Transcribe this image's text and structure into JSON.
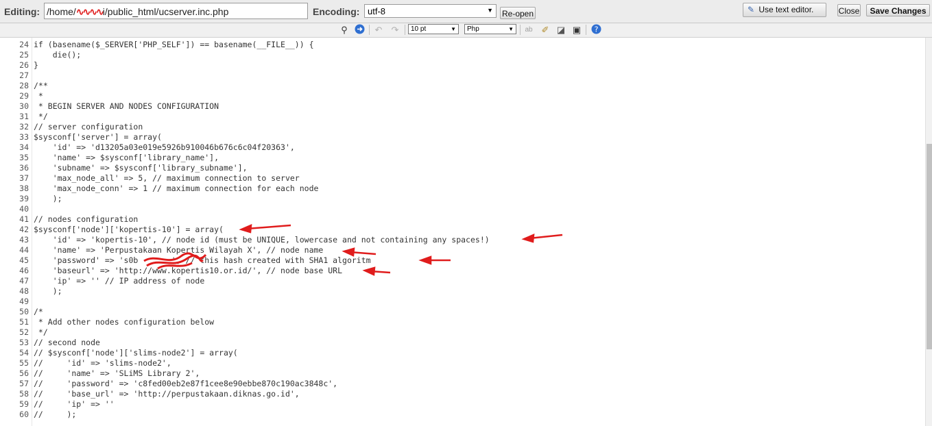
{
  "header": {
    "editing_label": "Editing:",
    "path_prefix": "/home/",
    "path_redacted": "∿∿∿∿",
    "path_suffix": "i/public_html/ucserver.inc.php",
    "encoding_label": "Encoding:",
    "encoding_value": "utf-8",
    "reopen_label": "Re-open",
    "use_text_editor_label": "Use text editor.",
    "close_label": "Close",
    "save_label": "Save Changes"
  },
  "toolbar": {
    "font_size": "10 pt",
    "syntax": "Php"
  },
  "code_lines": [
    {
      "n": "24",
      "t": "if (basename($_SERVER['PHP_SELF']) == basename(__FILE__)) {"
    },
    {
      "n": "25",
      "t": "    die();"
    },
    {
      "n": "26",
      "t": "}"
    },
    {
      "n": "27",
      "t": ""
    },
    {
      "n": "28",
      "t": "/**"
    },
    {
      "n": "29",
      "t": " *"
    },
    {
      "n": "30",
      "t": " * BEGIN SERVER AND NODES CONFIGURATION"
    },
    {
      "n": "31",
      "t": " */"
    },
    {
      "n": "32",
      "t": "// server configuration"
    },
    {
      "n": "33",
      "t": "$sysconf['server'] = array("
    },
    {
      "n": "34",
      "t": "    'id' => 'd13205a03e019e5926b910046b676c6c04f20363',"
    },
    {
      "n": "35",
      "t": "    'name' => $sysconf['library_name'],"
    },
    {
      "n": "36",
      "t": "    'subname' => $sysconf['library_subname'],"
    },
    {
      "n": "37",
      "t": "    'max_node_all' => 5, // maximum connection to server"
    },
    {
      "n": "38",
      "t": "    'max_node_conn' => 1 // maximum connection for each node"
    },
    {
      "n": "39",
      "t": "    );"
    },
    {
      "n": "40",
      "t": ""
    },
    {
      "n": "41",
      "t": "// nodes configuration"
    },
    {
      "n": "42",
      "t": "$sysconf['node']['kopertis-10'] = array("
    },
    {
      "n": "43",
      "t": "    'id' => 'kopertis-10', // node id (must be UNIQUE, lowercase and not containing any spaces!)"
    },
    {
      "n": "44",
      "t": "    'name' => 'Perpustakaan Kopertis Wilayah X', // node name"
    },
    {
      "n": "45",
      "t": "    'password' => 's0b       ', // this hash created with SHA1 algoritm"
    },
    {
      "n": "46",
      "t": "    'baseurl' => 'http://www.kopertis10.or.id/', // node base URL"
    },
    {
      "n": "47",
      "t": "    'ip' => '' // IP address of node"
    },
    {
      "n": "48",
      "t": "    );"
    },
    {
      "n": "49",
      "t": ""
    },
    {
      "n": "50",
      "t": "/*"
    },
    {
      "n": "51",
      "t": " * Add other nodes configuration below"
    },
    {
      "n": "52",
      "t": " */"
    },
    {
      "n": "53",
      "t": "// second node"
    },
    {
      "n": "54",
      "t": "// $sysconf['node']['slims-node2'] = array("
    },
    {
      "n": "55",
      "t": "//     'id' => 'slims-node2',"
    },
    {
      "n": "56",
      "t": "//     'name' => 'SLiMS Library 2',"
    },
    {
      "n": "57",
      "t": "//     'password' => 'c8fed00eb2e87f1cee8e90ebbe870c190ac3848c',"
    },
    {
      "n": "58",
      "t": "//     'base_url' => 'http://perpustakaan.diknas.go.id',"
    },
    {
      "n": "59",
      "t": "//     'ip' => ''"
    },
    {
      "n": "60",
      "t": "//     );"
    }
  ],
  "colors": {
    "annotation_red": "#e01c1c",
    "code_text": "#333333"
  }
}
